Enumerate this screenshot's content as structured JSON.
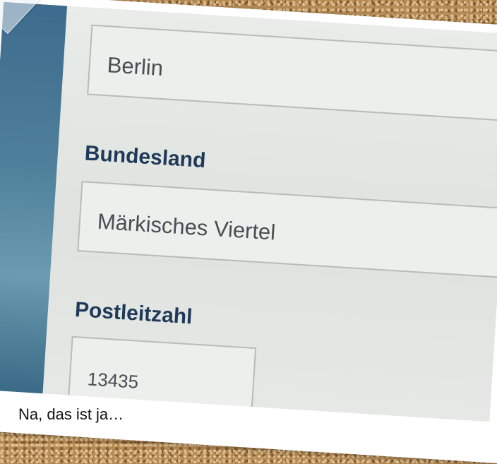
{
  "form": {
    "city_value": "Berlin",
    "state_label": "Bundesland",
    "state_value": "Märkisches Viertel",
    "zip_label": "Postleitzahl",
    "zip_value": "13435"
  },
  "caption": "Na, das ist ja…",
  "colors": {
    "label": "#1f3a58",
    "input_text": "#4a4d52",
    "sidebar": "#4e7f9a",
    "corkboard": "#b58a55"
  }
}
